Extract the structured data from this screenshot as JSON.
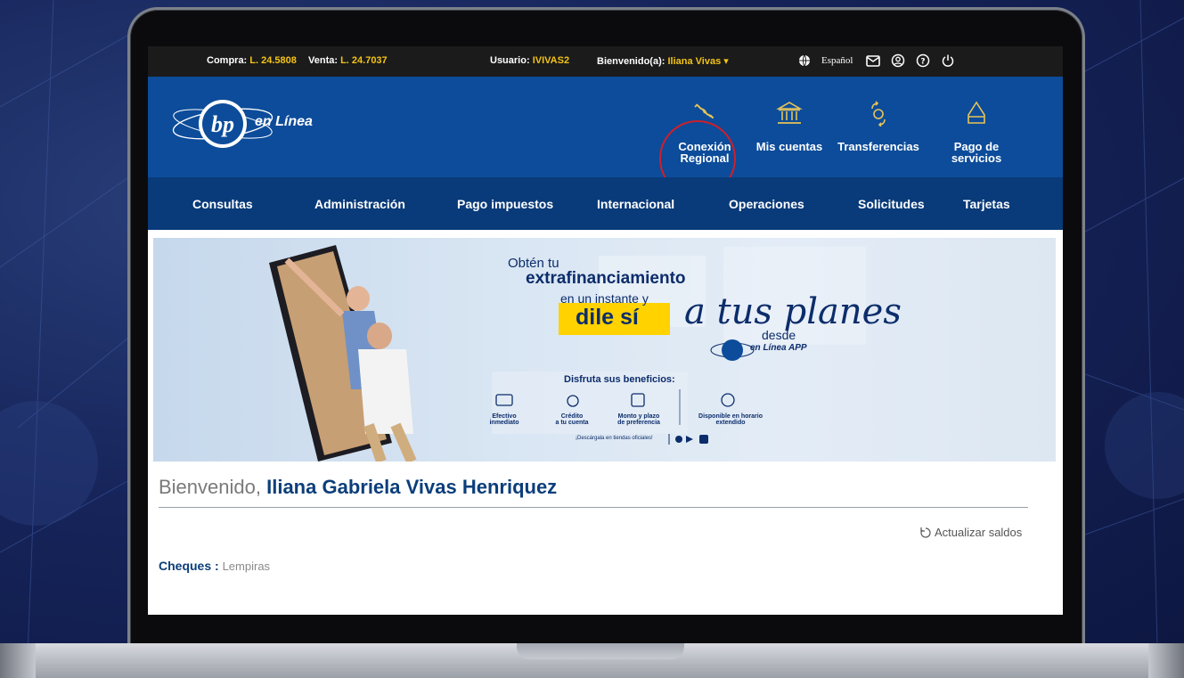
{
  "topbar": {
    "compra_label": "Compra:",
    "compra_value": "L. 24.5808",
    "venta_label": "Venta:",
    "venta_value": "L. 24.7037",
    "usuario_label": "Usuario:",
    "usuario_value": "IVIVAS2",
    "bienvenido_label": "Bienvenido(a):",
    "bienvenido_value": "Iliana Vivas",
    "language": "Español"
  },
  "header": {
    "logo_mark": "bp",
    "logo_text": "en Línea",
    "quick_actions": [
      {
        "label_1": "Conexión",
        "label_2": "Regional",
        "icon": "map-route-icon"
      },
      {
        "label_1": "Mis cuentas",
        "label_2": "",
        "icon": "bank-building-icon"
      },
      {
        "label_1": "Transferencias",
        "label_2": "",
        "icon": "transfer-arrows-icon"
      },
      {
        "label_1": "Pago de",
        "label_2": "servicios",
        "icon": "utility-bill-icon"
      }
    ]
  },
  "nav": {
    "items": [
      "Consultas",
      "Administración",
      "Pago impuestos",
      "Internacional",
      "Operaciones",
      "Solicitudes",
      "Tarjetas"
    ]
  },
  "banner": {
    "line1": "Obtén tu",
    "line2": "extrafinanciamiento",
    "line3": "en un instante y",
    "line4": "dile sí",
    "script": "a tus planes",
    "desde": "desde",
    "app_name": "en Línea APP",
    "benefits_title": "Disfruta sus beneficios:",
    "benefits": [
      {
        "l1": "Efectivo",
        "l2": "inmediato"
      },
      {
        "l1": "Crédito",
        "l2": "a tu cuenta"
      },
      {
        "l1": "Monto y plazo",
        "l2": "de preferencia"
      },
      {
        "l1": "Disponible en horario",
        "l2": "extendido"
      }
    ],
    "download": "¡Descárgala en tiendas oficiales!"
  },
  "content": {
    "welcome_prefix": "Bienvenido,",
    "welcome_name": "Iliana Gabriela Vivas Henriquez",
    "refresh_label": "Actualizar saldos",
    "cheques_label": "Cheques :",
    "cheques_currency": "Lempiras"
  },
  "colors": {
    "header_blue": "#0c4c9a",
    "nav_blue": "#093a79",
    "topbar_bg": "#1b1b1b",
    "highlight_yellow": "#f3c316",
    "accent_gold": "#e6c35a",
    "annotation_red": "#d01f2a"
  }
}
